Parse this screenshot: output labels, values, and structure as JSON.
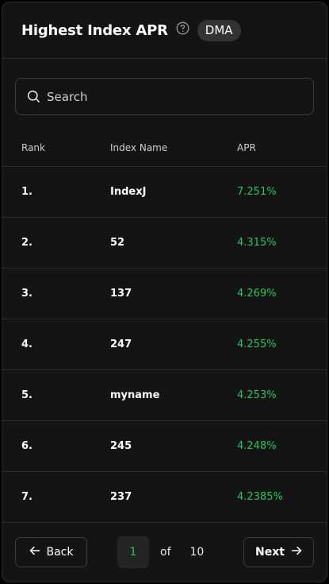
{
  "header": {
    "title": "Highest Index APR",
    "badge": "DMA",
    "help_icon": "question-circle-icon"
  },
  "search": {
    "placeholder": "Search",
    "value": "",
    "icon": "search-icon"
  },
  "table": {
    "columns": [
      "Rank",
      "Index Name",
      "APR"
    ],
    "rows": [
      {
        "rank": "1.",
        "name": "IndexJ",
        "apr": "7.251%"
      },
      {
        "rank": "2.",
        "name": "52",
        "apr": "4.315%"
      },
      {
        "rank": "3.",
        "name": "137",
        "apr": "4.269%"
      },
      {
        "rank": "4.",
        "name": "247",
        "apr": "4.255%"
      },
      {
        "rank": "5.",
        "name": "myname",
        "apr": "4.253%"
      },
      {
        "rank": "6.",
        "name": "245",
        "apr": "4.248%"
      },
      {
        "rank": "7.",
        "name": "237",
        "apr": "4.2385%"
      }
    ]
  },
  "pagination": {
    "back_label": "Back",
    "next_label": "Next",
    "current_page": "1",
    "of_label": "of",
    "total_pages": "10"
  },
  "colors": {
    "accent_green": "#22c55e",
    "background": "#141414",
    "border": "#2c2c2c"
  }
}
